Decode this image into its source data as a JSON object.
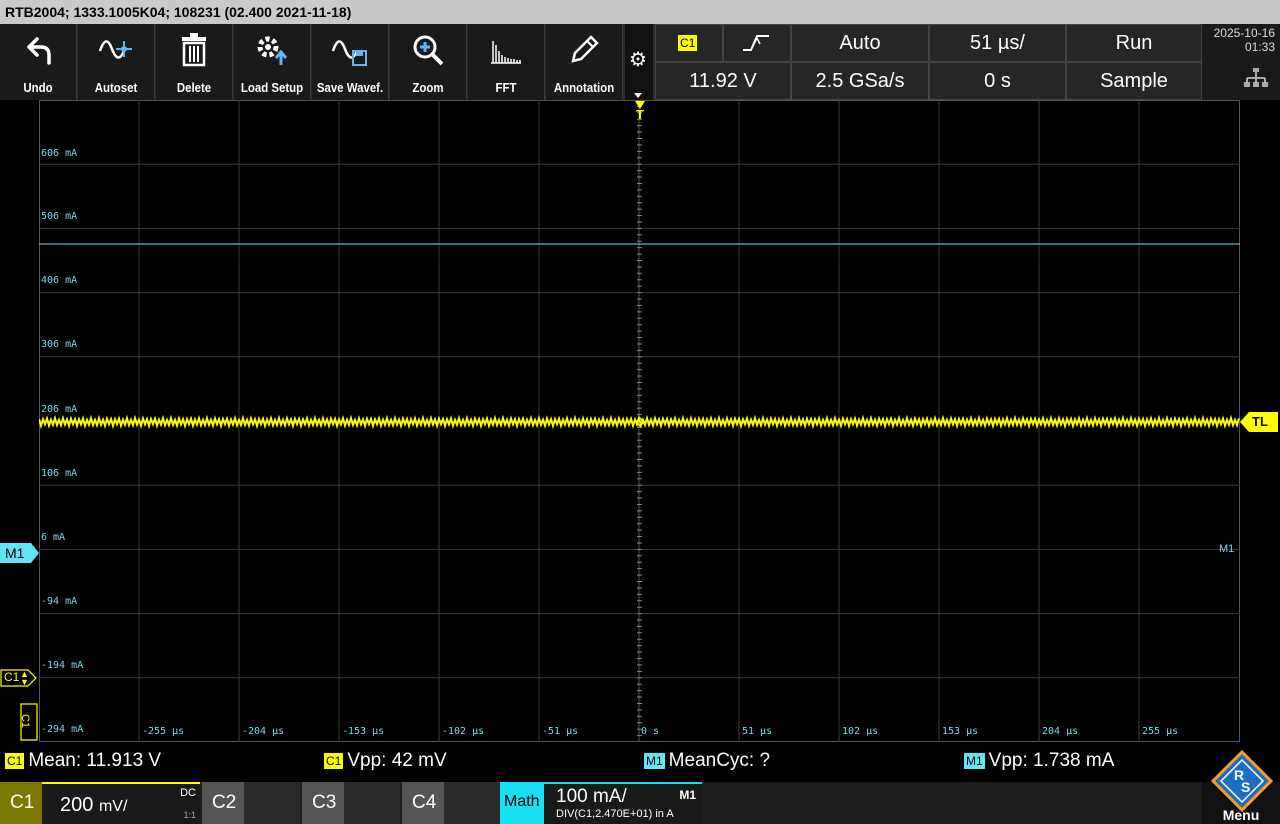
{
  "title": "RTB2004; 1333.1005K04; 108231 (02.400 2021-11-18)",
  "toolbar": [
    {
      "label": "Undo",
      "icon": "undo-icon"
    },
    {
      "label": "Autoset",
      "icon": "autoset-icon"
    },
    {
      "label": "Delete",
      "icon": "trash-icon"
    },
    {
      "label": "Load Setup",
      "icon": "load-setup-icon"
    },
    {
      "label": "Save Wavef.",
      "icon": "save-waveform-icon"
    },
    {
      "label": "Zoom",
      "icon": "zoom-icon"
    },
    {
      "label": "FFT",
      "icon": "fft-icon"
    },
    {
      "label": "Annotation",
      "icon": "pencil-icon"
    }
  ],
  "trigger": {
    "source": "C1",
    "level": "11.92 V",
    "mode": "Auto"
  },
  "acq": {
    "sample_rate": "2.5 GSa/s",
    "timebase": "51 µs/",
    "offset": "0 s",
    "run_state": "Run",
    "acq_mode": "Sample"
  },
  "datetime": {
    "date": "2025-10-16",
    "time": "01:33"
  },
  "y_labels": [
    "606 mA",
    "506 mA",
    "406 mA",
    "306 mA",
    "206 mA",
    "106 mA",
    "6 mA",
    "-94 mA",
    "-194 mA",
    "-294 mA"
  ],
  "x_labels": [
    "-255 µs",
    "-204 µs",
    "-153 µs",
    "-102 µs",
    "-51 µs",
    "0 s",
    "51 µs",
    "102 µs",
    "153 µs",
    "204 µs",
    "255 µs"
  ],
  "markers": {
    "trigger_top": "T",
    "trigger_level": "TL",
    "m1_left": "M1",
    "m1_right": "M1",
    "c1_left": "C1",
    "c1_bottom": "C1"
  },
  "measurements": [
    {
      "badge": "C1",
      "text": "Mean: 11.913 V",
      "kind": "c"
    },
    {
      "badge": "C1",
      "text": "Vpp: 42 mV",
      "kind": "c"
    },
    {
      "badge": "M1",
      "text": "MeanCyc: ?",
      "kind": "m"
    },
    {
      "badge": "M1",
      "text": "Vpp: 1.738 mA",
      "kind": "m"
    }
  ],
  "channels": {
    "c1": {
      "name": "C1",
      "scale": "200",
      "unit": "mV/",
      "coupling": "DC",
      "ratio": "1:1"
    },
    "c2": {
      "name": "C2"
    },
    "c3": {
      "name": "C3"
    },
    "c4": {
      "name": "C4"
    },
    "math": {
      "name": "Math",
      "scale": "100 mA/",
      "tag": "M1",
      "expr": "DIV(C1,2.470E+01) in A"
    }
  },
  "menu_label": "Menu",
  "colors": {
    "ch1": "#ffff00",
    "math": "#5fe6f5",
    "grid": "#3a3a3a"
  }
}
